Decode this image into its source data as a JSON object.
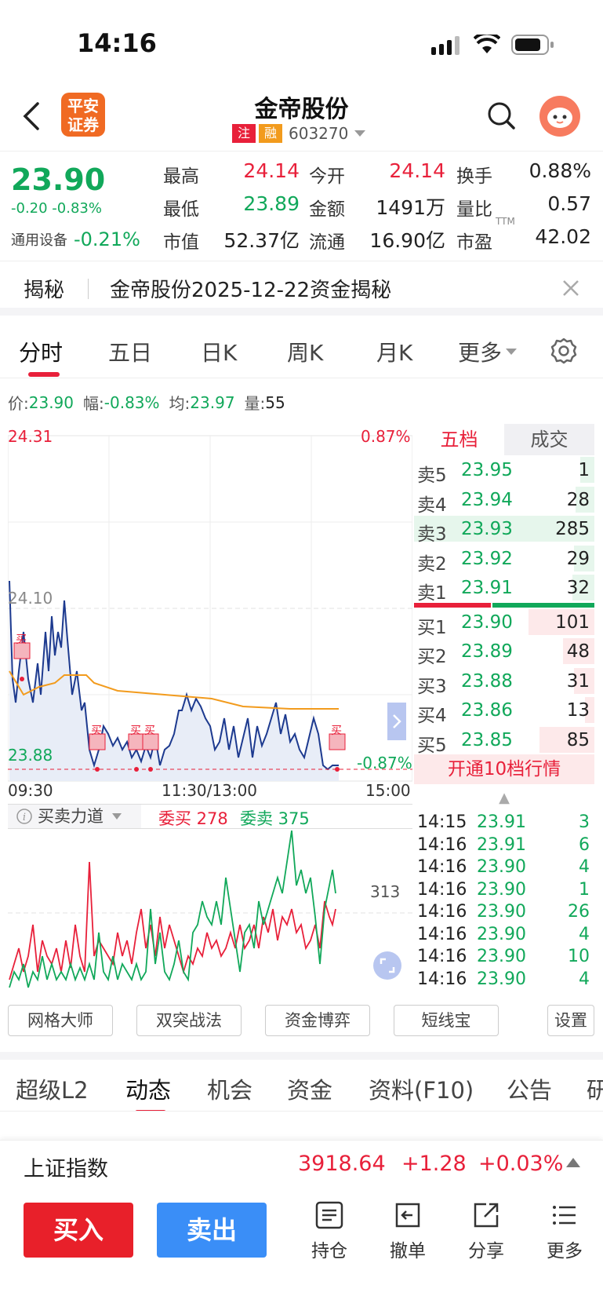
{
  "status_bar": {
    "time": "14:16"
  },
  "header": {
    "logo_line1": "平安",
    "logo_line2": "证券",
    "stock_name": "金帝股份",
    "badge_zhu": "注",
    "badge_rong": "融",
    "stock_code": "603270"
  },
  "quote": {
    "price": "23.90",
    "change": "-0.20 -0.83%",
    "sector_name": "通用设备",
    "sector_change": "-0.21%",
    "rows": [
      [
        {
          "label": "最高",
          "value": "24.14",
          "color": "red"
        },
        {
          "label": "今开",
          "value": "24.14",
          "color": "red"
        },
        {
          "label": "换手",
          "value": "0.88%",
          "color": "black"
        }
      ],
      [
        {
          "label": "最低",
          "value": "23.89",
          "color": "green"
        },
        {
          "label": "金额",
          "value": "1491万",
          "color": "black"
        },
        {
          "label": "量比",
          "value": "0.57",
          "color": "black"
        }
      ],
      [
        {
          "label": "市值",
          "value": "52.37亿",
          "color": "black"
        },
        {
          "label": "流通",
          "value": "16.90亿",
          "color": "black"
        },
        {
          "label": "市盈",
          "value": "42.02",
          "color": "black"
        }
      ]
    ],
    "pe_superscript": "TTM"
  },
  "banner": {
    "tag": "揭秘",
    "text": "金帝股份2025-12-22资金揭秘"
  },
  "period_tabs": [
    "分时",
    "五日",
    "日K",
    "周K",
    "月K",
    "更多"
  ],
  "info_line": {
    "price_label": "价:",
    "price": "23.90",
    "amp_label": "幅:",
    "amp": "-0.83%",
    "avg_label": "均:",
    "avg": "23.97",
    "vol_label": "量:",
    "vol": "55"
  },
  "chart": {
    "y_top": "24.31",
    "y_mid": "24.10",
    "y_bottom": "23.88",
    "pct_top": "0.87%",
    "pct_bottom": "-0.87%",
    "time_start": "09:30",
    "time_mid": "11:30/13:00",
    "time_end": "15:00",
    "buy_marker": "买",
    "right_value": "313"
  },
  "orderbook": {
    "tab_five": "五档",
    "tab_trade": "成交",
    "asks": [
      {
        "label": "卖5",
        "price": "23.95",
        "vol": "1"
      },
      {
        "label": "卖4",
        "price": "23.94",
        "vol": "28"
      },
      {
        "label": "卖3",
        "price": "23.93",
        "vol": "285"
      },
      {
        "label": "卖2",
        "price": "23.92",
        "vol": "29"
      },
      {
        "label": "卖1",
        "price": "23.91",
        "vol": "32"
      }
    ],
    "bids": [
      {
        "label": "买1",
        "price": "23.90",
        "vol": "101"
      },
      {
        "label": "买2",
        "price": "23.89",
        "vol": "48"
      },
      {
        "label": "买3",
        "price": "23.88",
        "vol": "31"
      },
      {
        "label": "买4",
        "price": "23.86",
        "vol": "13"
      },
      {
        "label": "买5",
        "price": "23.85",
        "vol": "85"
      }
    ],
    "upgrade": "开通10档行情",
    "trades": [
      {
        "time": "14:15",
        "price": "23.91",
        "vol": "3"
      },
      {
        "time": "14:16",
        "price": "23.91",
        "vol": "6"
      },
      {
        "time": "14:16",
        "price": "23.90",
        "vol": "4"
      },
      {
        "time": "14:16",
        "price": "23.90",
        "vol": "1"
      },
      {
        "time": "14:16",
        "price": "23.90",
        "vol": "26"
      },
      {
        "time": "14:16",
        "price": "23.90",
        "vol": "4"
      },
      {
        "time": "14:16",
        "price": "23.90",
        "vol": "10"
      },
      {
        "time": "14:16",
        "price": "23.90",
        "vol": "4"
      }
    ]
  },
  "indicator": {
    "selector": "买卖力道",
    "buy_label": "委买 278",
    "sell_label": "委卖 375"
  },
  "tools": [
    "网格大师",
    "双突战法",
    "资金博弈",
    "短线宝",
    "设置"
  ],
  "section_tabs": [
    "超级L2",
    "动态",
    "机会",
    "资金",
    "资料(F10)",
    "公告",
    "研"
  ],
  "index_bar": {
    "name": "上证指数",
    "value": "3918.64",
    "change": "+1.28",
    "pct": "+0.03%"
  },
  "bottom": {
    "buy": "买入",
    "sell": "卖出",
    "items": [
      "持仓",
      "撤单",
      "分享",
      "更多"
    ]
  },
  "colors": {
    "up": "#e8203a",
    "down": "#11a85a",
    "accent": "#3a8ef7"
  }
}
